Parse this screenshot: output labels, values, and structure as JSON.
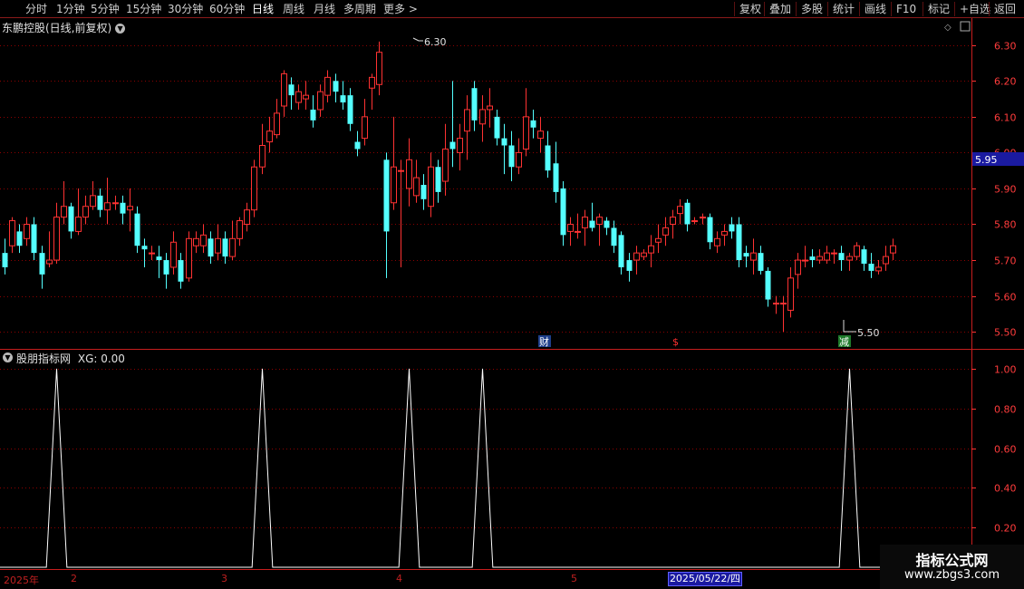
{
  "toolbar": {
    "left": [
      "分时",
      "1分钟",
      "5分钟",
      "15分钟",
      "30分钟",
      "60分钟",
      "日线",
      "周线",
      "月线",
      "多周期",
      "更多"
    ],
    "active": "日线",
    "more_icon": "chevron-right-icon",
    "right": [
      "复权",
      "叠加",
      "多股",
      "统计",
      "画线",
      "F10",
      "标记",
      "+自选",
      "返回"
    ]
  },
  "main_chart": {
    "title": "东鹏控股(日线,前复权)",
    "dropdown_icon": "chevron-down-icon",
    "y_ticks": [
      "6.30",
      "6.20",
      "6.10",
      "6.00",
      "5.90",
      "5.80",
      "5.70",
      "5.60",
      "5.50"
    ],
    "current_price": "5.95",
    "high_label": "6.30",
    "low_label": "5.50",
    "event_markers": [
      "财",
      "$",
      "减"
    ],
    "colors": {
      "up": "#ff3232",
      "down": "#54ffff",
      "grid": "#8b0000",
      "axis": "#ff3232",
      "price_box": "#1a1aa0"
    }
  },
  "indicator": {
    "title": "股朋指标网",
    "series_label": "XG: 0.00",
    "y_ticks": [
      "1.00",
      "0.80",
      "0.60",
      "0.40",
      "0.20"
    ]
  },
  "chart_data": [
    {
      "type": "candlestick",
      "ylim": [
        5.47,
        6.35
      ],
      "y_ticks": [
        5.5,
        5.6,
        5.7,
        5.8,
        5.9,
        6.0,
        6.1,
        6.2,
        6.3
      ],
      "candles": [
        [
          5.72,
          5.68,
          5.76,
          5.66
        ],
        [
          5.74,
          5.81,
          5.82,
          5.72
        ],
        [
          5.78,
          5.74,
          5.8,
          5.72
        ],
        [
          5.76,
          5.8,
          5.82,
          5.74
        ],
        [
          5.8,
          5.72,
          5.82,
          5.7
        ],
        [
          5.72,
          5.66,
          5.74,
          5.62
        ],
        [
          5.69,
          5.7,
          5.78,
          5.68
        ],
        [
          5.7,
          5.82,
          5.86,
          5.69
        ],
        [
          5.82,
          5.85,
          5.92,
          5.8
        ],
        [
          5.85,
          5.78,
          5.86,
          5.76
        ],
        [
          5.78,
          5.82,
          5.9,
          5.77
        ],
        [
          5.82,
          5.85,
          5.88,
          5.8
        ],
        [
          5.85,
          5.88,
          5.92,
          5.84
        ],
        [
          5.88,
          5.84,
          5.9,
          5.82
        ],
        [
          5.84,
          5.86,
          5.93,
          5.8
        ],
        [
          5.86,
          5.86,
          5.88,
          5.84
        ],
        [
          5.86,
          5.83,
          5.88,
          5.8
        ],
        [
          5.84,
          5.85,
          5.9,
          5.78
        ],
        [
          5.83,
          5.74,
          5.85,
          5.72
        ],
        [
          5.74,
          5.73,
          5.76,
          5.68
        ],
        [
          5.72,
          5.72,
          5.74,
          5.7
        ],
        [
          5.71,
          5.7,
          5.74,
          5.65
        ],
        [
          5.7,
          5.66,
          5.72,
          5.62
        ],
        [
          5.68,
          5.75,
          5.78,
          5.66
        ],
        [
          5.7,
          5.64,
          5.72,
          5.62
        ],
        [
          5.65,
          5.76,
          5.78,
          5.64
        ],
        [
          5.74,
          5.76,
          5.78,
          5.72
        ],
        [
          5.74,
          5.77,
          5.8,
          5.72
        ],
        [
          5.76,
          5.71,
          5.78,
          5.69
        ],
        [
          5.72,
          5.76,
          5.8,
          5.7
        ],
        [
          5.76,
          5.71,
          5.78,
          5.69
        ],
        [
          5.71,
          5.76,
          5.81,
          5.7
        ],
        [
          5.76,
          5.81,
          5.82,
          5.74
        ],
        [
          5.8,
          5.84,
          5.86,
          5.78
        ],
        [
          5.84,
          5.96,
          5.98,
          5.82
        ],
        [
          5.96,
          6.02,
          6.08,
          5.94
        ],
        [
          6.03,
          6.06,
          6.1,
          6.0
        ],
        [
          6.05,
          6.11,
          6.15,
          6.04
        ],
        [
          6.13,
          6.22,
          6.23,
          6.1
        ],
        [
          6.19,
          6.16,
          6.21,
          6.12
        ],
        [
          6.14,
          6.17,
          6.19,
          6.12
        ],
        [
          6.15,
          6.16,
          6.2,
          6.12
        ],
        [
          6.12,
          6.09,
          6.16,
          6.07
        ],
        [
          6.12,
          6.17,
          6.19,
          6.1
        ],
        [
          6.16,
          6.21,
          6.23,
          6.14
        ],
        [
          6.2,
          6.17,
          6.22,
          6.14
        ],
        [
          6.16,
          6.14,
          6.2,
          6.12
        ],
        [
          6.16,
          6.08,
          6.18,
          6.06
        ],
        [
          6.03,
          6.01,
          6.06,
          5.99
        ],
        [
          6.04,
          6.1,
          6.15,
          6.02
        ],
        [
          6.18,
          6.21,
          6.22,
          6.12
        ],
        [
          6.19,
          6.28,
          6.31,
          6.16
        ],
        [
          5.98,
          5.78,
          6.0,
          5.65
        ],
        [
          5.86,
          5.96,
          6.1,
          5.84
        ],
        [
          5.95,
          5.95,
          5.98,
          5.68
        ],
        [
          5.9,
          5.98,
          6.04,
          5.85
        ],
        [
          5.88,
          5.93,
          5.98,
          5.86
        ],
        [
          5.91,
          5.87,
          5.94,
          5.84
        ],
        [
          5.85,
          5.96,
          6.0,
          5.82
        ],
        [
          5.96,
          5.89,
          5.98,
          5.86
        ],
        [
          5.92,
          6.01,
          6.08,
          5.88
        ],
        [
          6.03,
          6.01,
          6.2,
          5.96
        ],
        [
          6.0,
          6.04,
          6.08,
          5.95
        ],
        [
          6.06,
          6.12,
          6.16,
          5.98
        ],
        [
          6.18,
          6.09,
          6.2,
          6.06
        ],
        [
          6.08,
          6.12,
          6.16,
          6.03
        ],
        [
          6.12,
          6.13,
          6.18,
          6.07
        ],
        [
          6.1,
          6.04,
          6.12,
          6.02
        ],
        [
          6.04,
          6.02,
          6.08,
          5.94
        ],
        [
          6.02,
          5.96,
          6.06,
          5.92
        ],
        [
          5.96,
          6.0,
          6.04,
          5.94
        ],
        [
          6.01,
          6.1,
          6.18,
          5.99
        ],
        [
          6.09,
          6.07,
          6.12,
          6.04
        ],
        [
          6.04,
          6.06,
          6.1,
          6.0
        ],
        [
          6.02,
          5.95,
          6.06,
          5.93
        ],
        [
          5.97,
          5.89,
          6.03,
          5.86
        ],
        [
          5.9,
          5.77,
          5.92,
          5.74
        ],
        [
          5.78,
          5.8,
          5.82,
          5.74
        ],
        [
          5.78,
          5.78,
          5.83,
          5.76
        ],
        [
          5.79,
          5.82,
          5.84,
          5.74
        ],
        [
          5.81,
          5.79,
          5.86,
          5.78
        ],
        [
          5.8,
          5.82,
          5.83,
          5.74
        ],
        [
          5.81,
          5.79,
          5.82,
          5.77
        ],
        [
          5.79,
          5.74,
          5.81,
          5.72
        ],
        [
          5.77,
          5.68,
          5.78,
          5.66
        ],
        [
          5.7,
          5.67,
          5.72,
          5.64
        ],
        [
          5.7,
          5.72,
          5.74,
          5.66
        ],
        [
          5.71,
          5.72,
          5.73,
          5.7
        ],
        [
          5.72,
          5.74,
          5.77,
          5.68
        ],
        [
          5.75,
          5.76,
          5.8,
          5.72
        ],
        [
          5.77,
          5.79,
          5.82,
          5.74
        ],
        [
          5.8,
          5.82,
          5.84,
          5.76
        ],
        [
          5.83,
          5.85,
          5.87,
          5.8
        ],
        [
          5.86,
          5.8,
          5.87,
          5.78
        ],
        [
          5.81,
          5.81,
          5.82,
          5.8
        ],
        [
          5.82,
          5.82,
          5.83,
          5.8
        ],
        [
          5.82,
          5.75,
          5.83,
          5.73
        ],
        [
          5.74,
          5.76,
          5.78,
          5.72
        ],
        [
          5.77,
          5.78,
          5.8,
          5.74
        ],
        [
          5.8,
          5.78,
          5.82,
          5.76
        ],
        [
          5.8,
          5.7,
          5.82,
          5.68
        ],
        [
          5.72,
          5.71,
          5.74,
          5.68
        ],
        [
          5.7,
          5.72,
          5.76,
          5.66
        ],
        [
          5.72,
          5.67,
          5.74,
          5.66
        ],
        [
          5.67,
          5.59,
          5.68,
          5.57
        ],
        [
          5.58,
          5.58,
          5.6,
          5.55
        ],
        [
          5.58,
          5.58,
          5.6,
          5.5
        ],
        [
          5.56,
          5.65,
          5.68,
          5.54
        ],
        [
          5.66,
          5.7,
          5.72,
          5.62
        ],
        [
          5.7,
          5.7,
          5.74,
          5.68
        ],
        [
          5.71,
          5.7,
          5.73,
          5.68
        ],
        [
          5.7,
          5.71,
          5.73,
          5.69
        ],
        [
          5.7,
          5.72,
          5.74,
          5.69
        ],
        [
          5.72,
          5.72,
          5.73,
          5.69
        ],
        [
          5.72,
          5.7,
          5.74,
          5.67
        ],
        [
          5.7,
          5.71,
          5.72,
          5.67
        ],
        [
          5.71,
          5.74,
          5.75,
          5.7
        ],
        [
          5.73,
          5.69,
          5.74,
          5.67
        ],
        [
          5.69,
          5.67,
          5.72,
          5.65
        ],
        [
          5.67,
          5.68,
          5.7,
          5.66
        ],
        [
          5.69,
          5.71,
          5.74,
          5.67
        ],
        [
          5.72,
          5.74,
          5.76,
          5.7
        ]
      ]
    },
    {
      "type": "line",
      "series": [
        {
          "name": "XG",
          "spikes_at_index": [
            7,
            35,
            55,
            65,
            115
          ]
        }
      ],
      "ylim": [
        0,
        1.05
      ],
      "y_ticks": [
        0.2,
        0.4,
        0.6,
        0.8,
        1.0
      ]
    }
  ],
  "time_axis": {
    "labels": [
      "2025年",
      "2",
      "3",
      "4",
      "5"
    ],
    "cursor_date": "2025/05/22/四"
  },
  "watermark": {
    "line1": "指标公式网",
    "line2": "www.zbgs3.com"
  }
}
